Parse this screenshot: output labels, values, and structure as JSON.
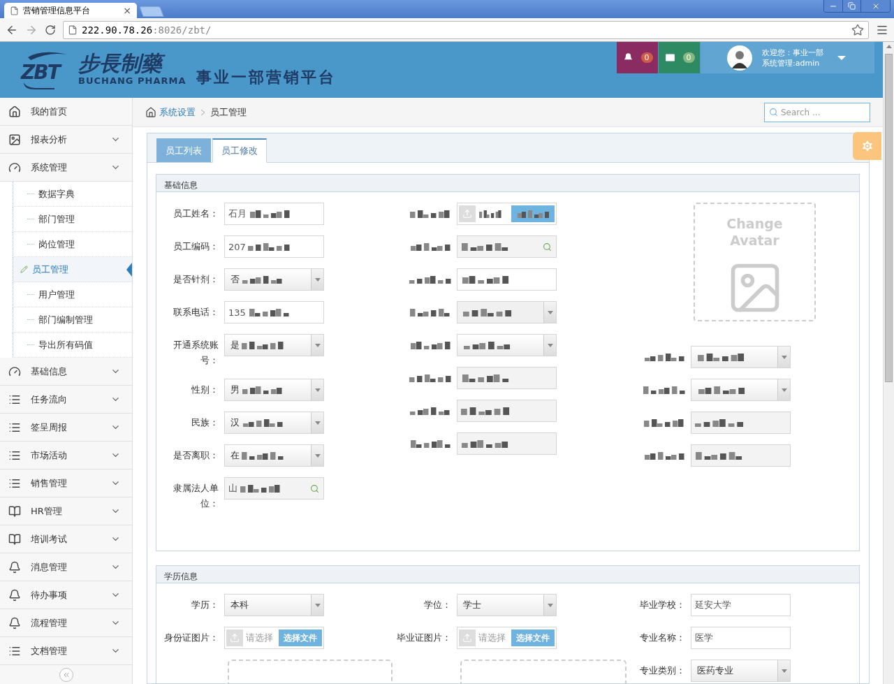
{
  "browser": {
    "tab_title": "营销管理信息平台",
    "tab_close": "×",
    "url_host": "222.90.78.26",
    "url_path": ":8026/zbt/"
  },
  "header": {
    "logo_mark": "ZBT",
    "logo_cn": "步長制藥",
    "logo_en": "BUCHANG PHARMA",
    "platform_title": "事业一部营销平台",
    "alerts": [
      {
        "kind": "bell",
        "count": "0",
        "color": "#8a2b62"
      },
      {
        "kind": "mail",
        "count": "0",
        "color": "#2e8a63"
      }
    ],
    "user": {
      "greeting": "欢迎您：事业一部",
      "role": "系统管理:admin"
    }
  },
  "sidebar": {
    "items": [
      {
        "label": "我的首页",
        "kind": "home"
      },
      {
        "label": "报表分析",
        "kind": "image"
      },
      {
        "label": "系统管理",
        "kind": "gauge",
        "children": [
          {
            "label": "数据字典",
            "selected": false
          },
          {
            "label": "部门管理",
            "selected": false
          },
          {
            "label": "岗位管理",
            "selected": false
          },
          {
            "label": "员工管理",
            "selected": true
          },
          {
            "label": "用户管理",
            "selected": false
          },
          {
            "label": "部门编制管理",
            "selected": false
          },
          {
            "label": "导出所有码值",
            "selected": false
          }
        ]
      },
      {
        "label": "基础信息",
        "kind": "gauge"
      },
      {
        "label": "任务流向",
        "kind": "list"
      },
      {
        "label": "签呈周报",
        "kind": "list"
      },
      {
        "label": "市场活动",
        "kind": "list"
      },
      {
        "label": "销售管理",
        "kind": "list"
      },
      {
        "label": "HR管理",
        "kind": "book"
      },
      {
        "label": "培训考试",
        "kind": "book"
      },
      {
        "label": "消息管理",
        "kind": "bell"
      },
      {
        "label": "待办事项",
        "kind": "bell"
      },
      {
        "label": "流程管理",
        "kind": "bell"
      },
      {
        "label": "文档管理",
        "kind": "list"
      }
    ]
  },
  "breadcrumb": {
    "items": [
      "系统设置",
      "员工管理"
    ],
    "search_placeholder": "Search ..."
  },
  "tabs": [
    {
      "label": "员工列表",
      "selected": false
    },
    {
      "label": "员工修改",
      "selected": true
    }
  ],
  "basic_section": {
    "title": "基础信息",
    "avatar_text": "Change Avatar",
    "columns": [
      [
        {
          "label": "员工姓名：",
          "kind": "input",
          "value": "石月",
          "masked": true,
          "readonly": false
        },
        {
          "label": "员工编码：",
          "kind": "input",
          "value": "207",
          "masked": true,
          "readonly": false
        },
        {
          "label": "是否针剂：",
          "kind": "select",
          "value": "否",
          "masked": true,
          "readonly": false
        },
        {
          "label": "联系电话：",
          "kind": "input",
          "value": "135",
          "masked": true,
          "readonly": false
        },
        {
          "label": "开通系统账号：",
          "kind": "select",
          "value": "是",
          "masked": true,
          "readonly": false
        },
        {
          "label": "性别：",
          "kind": "select",
          "value": "男",
          "masked": true,
          "readonly": false
        },
        {
          "label": "民族：",
          "kind": "select",
          "value": "汉",
          "masked": true,
          "readonly": false
        },
        {
          "label": "是否离职：",
          "kind": "select",
          "value": "在",
          "masked": true,
          "readonly": false
        },
        {
          "label": "隶属法人单位：",
          "kind": "lookup",
          "value": "山",
          "masked": true,
          "readonly": true
        }
      ],
      [
        {
          "label_masked": true,
          "kind": "upload",
          "masked": true,
          "readonly": false
        },
        {
          "label_masked": true,
          "kind": "lookup",
          "masked": true,
          "readonly": true
        },
        {
          "label_masked": true,
          "kind": "input",
          "masked": true,
          "readonly": false
        },
        {
          "label_masked": true,
          "kind": "select",
          "masked": true,
          "readonly": true
        },
        {
          "label_masked": true,
          "kind": "select",
          "masked": true,
          "readonly": false
        },
        {
          "label_masked": true,
          "kind": "input",
          "masked": true,
          "readonly": true
        },
        {
          "label_masked": true,
          "kind": "input",
          "masked": true,
          "readonly": true
        },
        {
          "label_masked": true,
          "kind": "input",
          "masked": true,
          "readonly": true
        }
      ],
      [
        {
          "label_masked": true,
          "kind": "select",
          "masked": true,
          "readonly": false
        },
        {
          "label_masked": true,
          "kind": "select",
          "masked": true,
          "readonly": false
        },
        {
          "label_masked": true,
          "kind": "input",
          "masked": true,
          "readonly": true
        },
        {
          "label_masked": true,
          "kind": "input",
          "masked": true,
          "readonly": true
        }
      ]
    ]
  },
  "education_section": {
    "title": "学历信息",
    "columns": [
      [
        {
          "label": "学历：",
          "kind": "select",
          "value": "本科",
          "masked": false,
          "readonly": false
        },
        {
          "label": "身份证图片：",
          "kind": "upload",
          "placeholder": "请选择",
          "button": "选择文件",
          "masked": false,
          "readonly": false
        },
        {
          "kind": "preview"
        }
      ],
      [
        {
          "label": "学位：",
          "kind": "select",
          "value": "学士",
          "masked": false,
          "readonly": false
        },
        {
          "label": "毕业证图片：",
          "kind": "upload",
          "placeholder": "请选择",
          "button": "选择文件",
          "masked": false,
          "readonly": false
        },
        {
          "kind": "preview"
        }
      ],
      [
        {
          "label": "毕业学校：",
          "kind": "input",
          "value": "延安大学",
          "masked": false,
          "readonly": false
        },
        {
          "label": "专业名称：",
          "kind": "input",
          "value": "医学",
          "masked": false,
          "readonly": false
        },
        {
          "label": "专业类别：",
          "kind": "select",
          "value": "医药专业",
          "masked": false,
          "readonly": false
        }
      ]
    ]
  }
}
